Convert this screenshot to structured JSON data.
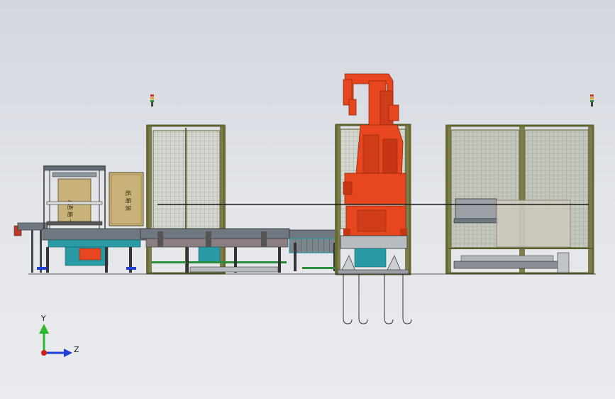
{
  "triad": {
    "y_label": "Y",
    "z_label": "Z",
    "y_color": "#2db82d",
    "z_color": "#1f3fd6",
    "origin_color": "#d41c1c"
  },
  "cartons": {
    "left_label": "/ 酒 箱 卡",
    "right_label": "纸 箱 装"
  },
  "colors": {
    "robot": "#e8461e",
    "robot_dark": "#b8320f",
    "frame": "#5d5e2a",
    "mesh": "#c9cdc5",
    "conveyor": "#6f7880",
    "conveyor_dark": "#3f464d",
    "teal": "#2a9aa5",
    "carton": "#c8b27a",
    "carton_dark": "#8a7340",
    "guard_line": "#1a1a1a"
  }
}
